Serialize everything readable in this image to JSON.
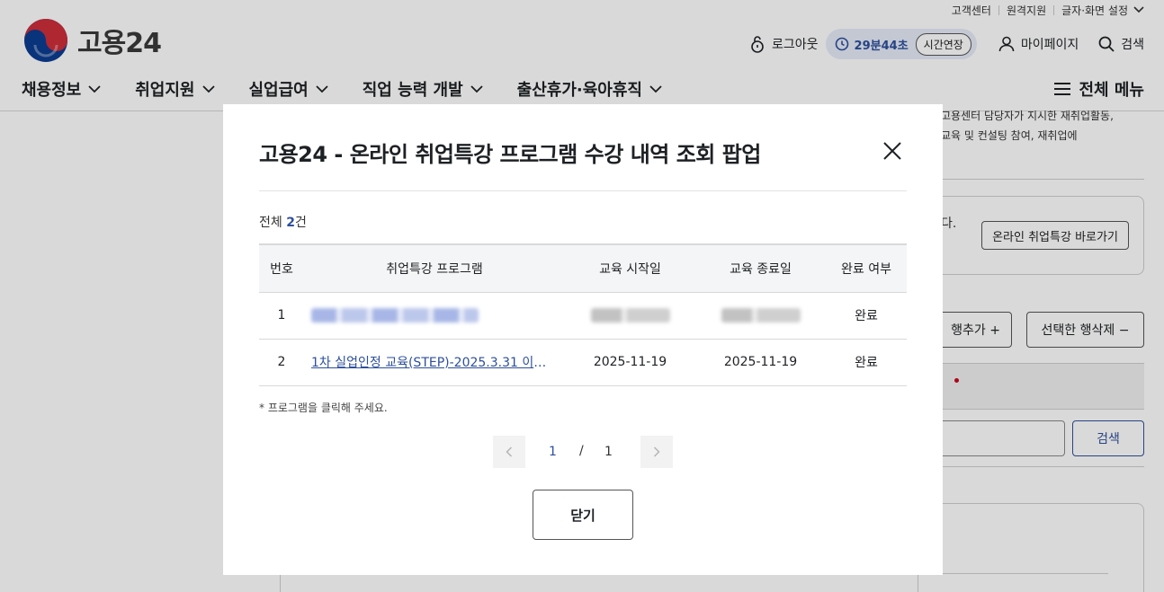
{
  "util_links": [
    "고객센터",
    "원격지원",
    "글자·화면 설정"
  ],
  "logo": {
    "text": "고용24"
  },
  "user_bar": {
    "logout": "로그아웃",
    "timer": "29분44초",
    "extend": "시간연장",
    "mypage": "마이페이지",
    "search": "검색"
  },
  "gnb": [
    "채용정보",
    "취업지원",
    "실업급여",
    "직업 능력 개발",
    "출산휴가·육아휴직"
  ],
  "all_menu": "전체 메뉴",
  "background": {
    "desc_line1": "고용센터 담당자가 지시한 재취업활동,",
    "desc_line2": "교육 및 컨설팅 참여, 재취업에",
    "box_text": "다.",
    "shortcut": "온라인 취업특강 바로가기",
    "add_row": "행추가 +",
    "delete_row": "선택한 행삭제 −",
    "bar_text": ")",
    "search_button": "검색"
  },
  "modal": {
    "title": "고용24 - 온라인 취업특강 프로그램 수강 내역 조회 팝업",
    "total_prefix": "전체 ",
    "total_count": "2",
    "total_suffix": "건",
    "columns": [
      "번호",
      "취업특강 프로그램",
      "교육 시작일",
      "교육 종료일",
      "완료 여부"
    ],
    "rows": [
      {
        "no": "1",
        "program": "",
        "start": "",
        "end": "",
        "done": "완료",
        "redacted": true
      },
      {
        "no": "2",
        "program": "1차 실업인정 교육(STEP)-2025.3.31 이후 ...",
        "start": "2025-11-19",
        "end": "2025-11-19",
        "done": "완료",
        "redacted": false
      }
    ],
    "note": "* 프로그램을 클릭해 주세요.",
    "pagination": {
      "current": "1",
      "separator": "/",
      "total": "1"
    },
    "close_label": "닫기"
  },
  "colors": {
    "brand_blue": "#2d4f9c",
    "brand_red": "#cd2e3a",
    "overlay": "rgba(0,0,0,0.15)"
  }
}
